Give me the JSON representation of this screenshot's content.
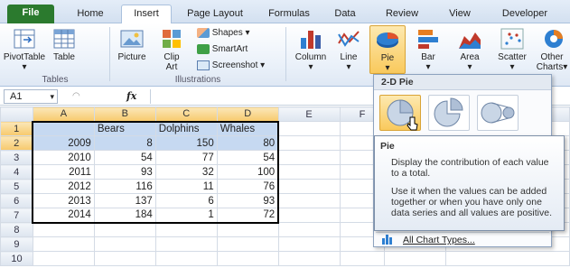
{
  "tabs": [
    {
      "label": "File",
      "kind": "file"
    },
    {
      "label": "Home",
      "kind": ""
    },
    {
      "label": "Insert",
      "kind": "active"
    },
    {
      "label": "Page Layout",
      "kind": ""
    },
    {
      "label": "Formulas",
      "kind": ""
    },
    {
      "label": "Data",
      "kind": ""
    },
    {
      "label": "Review",
      "kind": ""
    },
    {
      "label": "View",
      "kind": ""
    },
    {
      "label": "Developer",
      "kind": ""
    }
  ],
  "ribbon": {
    "pivot_label_1": "PivotTable",
    "table_label": "Table",
    "tables_group": "Tables",
    "picture_label": "Picture",
    "clip_label_1": "Clip",
    "clip_label_2": "Art",
    "shapes_label": "Shapes",
    "smartart_label": "SmartArt",
    "screenshot_label": "Screenshot",
    "illustrations_group": "Illustrations",
    "column_label": "Column",
    "line_label": "Line",
    "pie_label": "Pie",
    "bar_label": "Bar",
    "area_label": "Area",
    "scatter_label": "Scatter",
    "other_label_1": "Other",
    "other_label_2": "Charts"
  },
  "formula_bar": {
    "name_box": "A1",
    "fx": "fx",
    "value": ""
  },
  "grid": {
    "columns": [
      "A",
      "B",
      "C",
      "D",
      "E",
      "F",
      "I"
    ],
    "rows": [
      {
        "num": "1",
        "cells": [
          "",
          "Bears",
          "Dolphins",
          "Whales"
        ]
      },
      {
        "num": "2",
        "cells": [
          "2009",
          "8",
          "150",
          "80"
        ]
      },
      {
        "num": "3",
        "cells": [
          "2010",
          "54",
          "77",
          "54"
        ]
      },
      {
        "num": "4",
        "cells": [
          "2011",
          "93",
          "32",
          "100"
        ]
      },
      {
        "num": "5",
        "cells": [
          "2012",
          "116",
          "11",
          "76"
        ]
      },
      {
        "num": "6",
        "cells": [
          "2013",
          "137",
          "6",
          "93"
        ]
      },
      {
        "num": "7",
        "cells": [
          "2014",
          "184",
          "1",
          "72"
        ]
      },
      {
        "num": "8",
        "cells": [
          "",
          "",
          "",
          ""
        ]
      },
      {
        "num": "9",
        "cells": [
          "",
          "",
          "",
          ""
        ]
      },
      {
        "num": "10",
        "cells": [
          "",
          "",
          "",
          ""
        ]
      }
    ]
  },
  "dropdown": {
    "header": "2-D Pie",
    "all_chart_types": "All Chart Types..."
  },
  "tooltip": {
    "title": "Pie",
    "para1": "Display the contribution of each value to a total.",
    "para2": "Use it when the values can be added together or when you have only one data series and all values are positive."
  },
  "colors": {
    "file_tab": "#2b7a2e",
    "selection": "#c6d9f1",
    "header_selected": "#f7c96b"
  }
}
